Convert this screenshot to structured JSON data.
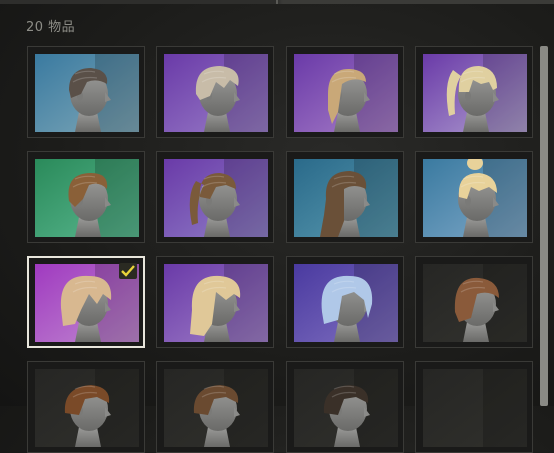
{
  "header": {
    "item_count": "20 物品"
  },
  "colors": {
    "check": "#e8d23a",
    "selected_border": "#e8e6dc"
  },
  "hairstyles": [
    {
      "name": "short-messy-dark",
      "bg": [
        "#3a7aa0",
        "#7fa8b8"
      ],
      "hair": "#5a5048",
      "style": "short",
      "selected": false
    },
    {
      "name": "short-tousled-blond",
      "bg": [
        "#6a3aa8",
        "#9a7fc8"
      ],
      "hair": "#c8bca8",
      "style": "tousled",
      "selected": false
    },
    {
      "name": "braided-blond",
      "bg": [
        "#6a3aa8",
        "#a87fc8"
      ],
      "hair": "#c9a878",
      "style": "braid",
      "selected": false
    },
    {
      "name": "ponytail-bangs-blond",
      "bg": [
        "#6a3aa8",
        "#b0a0d0"
      ],
      "hair": "#e0d0a0",
      "style": "ponytail",
      "selected": false
    },
    {
      "name": "short-curly-brown",
      "bg": [
        "#2a8a5a",
        "#5ab890"
      ],
      "hair": "#8a6038",
      "style": "curly",
      "selected": false
    },
    {
      "name": "ponytail-brown",
      "bg": [
        "#6a3aa8",
        "#9080c8"
      ],
      "hair": "#7a5a3a",
      "style": "ponytail2",
      "selected": false
    },
    {
      "name": "long-wavy-brown",
      "bg": [
        "#2a6a8a",
        "#5a9ab0"
      ],
      "hair": "#6a5038",
      "style": "long",
      "selected": false
    },
    {
      "name": "bun-blond",
      "bg": [
        "#3a7aa0",
        "#7fa8c8"
      ],
      "hair": "#e8d29a",
      "style": "bun",
      "selected": false
    },
    {
      "name": "messy-pink-blond",
      "bg": [
        "#a03ac0",
        "#c08ad0"
      ],
      "hair": "#d8b890",
      "style": "messy",
      "selected": true
    },
    {
      "name": "long-layered-blond",
      "bg": [
        "#6a3aa8",
        "#a080c8"
      ],
      "hair": "#e0c898",
      "style": "layered",
      "selected": false
    },
    {
      "name": "bob-silver-blue",
      "bg": [
        "#4a3aa0",
        "#8070c0"
      ],
      "hair": "#b0c8e8",
      "style": "bob",
      "selected": false
    },
    {
      "name": "bob-auburn",
      "bg": [
        "#262624",
        "#33332f"
      ],
      "hair": "#8a5a3a",
      "style": "bob2",
      "selected": false
    },
    {
      "name": "row4-a",
      "bg": [
        "#262624",
        "#30302c"
      ],
      "hair": "#7a4a28",
      "style": "partial",
      "selected": false
    },
    {
      "name": "row4-b",
      "bg": [
        "#262624",
        "#30302c"
      ],
      "hair": "#6a4a30",
      "style": "partial",
      "selected": false
    },
    {
      "name": "row4-c",
      "bg": [
        "#262624",
        "#30302c"
      ],
      "hair": "#3a3028",
      "style": "partial",
      "selected": false
    },
    {
      "name": "row4-d",
      "bg": [
        "#262624",
        "#30302c"
      ],
      "hair": "#262624",
      "style": "empty",
      "selected": false
    }
  ]
}
